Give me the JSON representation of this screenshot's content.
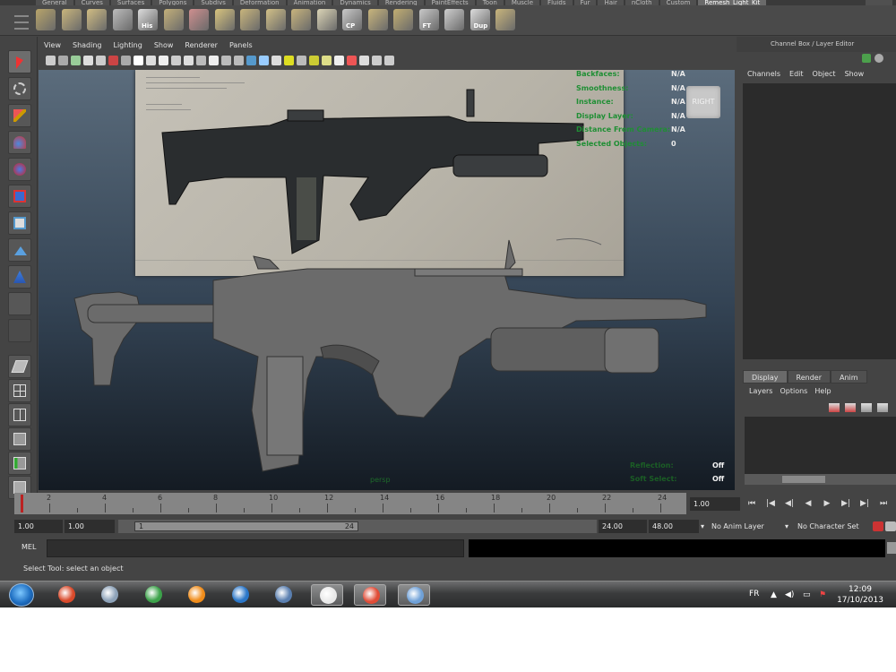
{
  "shelf_tabs": [
    "General",
    "Curves",
    "Surfaces",
    "Polygons",
    "Subdivs",
    "Deformation",
    "Animation",
    "Dynamics",
    "Rendering",
    "PaintEffects",
    "Toon",
    "Muscle",
    "Fluids",
    "Fur",
    "Hair",
    "nCloth",
    "Custom",
    "Remesh_Light_Kit"
  ],
  "shelf_icons": [
    {
      "name": "poly-cube-icon",
      "color": "#b8a46a",
      "label": ""
    },
    {
      "name": "poly-sphere-icon",
      "color": "#c9b57c",
      "label": ""
    },
    {
      "name": "extrude-icon",
      "color": "#d1bd83",
      "label": ""
    },
    {
      "name": "bevel-icon",
      "color": "#bcbcbc",
      "label": ""
    },
    {
      "name": "history-icon",
      "color": "#dddddd",
      "label": "His"
    },
    {
      "name": "merge-icon",
      "color": "#c4b07a",
      "label": ""
    },
    {
      "name": "split-icon",
      "color": "#cf8f8f",
      "label": ""
    },
    {
      "name": "grid-icon",
      "color": "#d8c47e",
      "label": ""
    },
    {
      "name": "plane-icon",
      "color": "#c9b57c",
      "label": ""
    },
    {
      "name": "cube-icon",
      "color": "#d2c087",
      "label": ""
    },
    {
      "name": "cylinder-icon",
      "color": "#c8b47d",
      "label": ""
    },
    {
      "name": "uv-icon",
      "color": "#dcd5b6",
      "label": ""
    },
    {
      "name": "center-pivot-icon",
      "color": "#c8c8c8",
      "label": "CP"
    },
    {
      "name": "barrel-icon",
      "color": "#c9b57c",
      "label": ""
    },
    {
      "name": "sphere-ball-icon",
      "color": "#c2ae72",
      "label": ""
    },
    {
      "name": "freeze-transform-icon",
      "color": "#c8c8c8",
      "label": "FT"
    },
    {
      "name": "layer-icon",
      "color": "#cfcfcf",
      "label": ""
    },
    {
      "name": "duplicate-icon",
      "color": "#dddddd",
      "label": "Dup"
    },
    {
      "name": "cone-icon",
      "color": "#c9b57c",
      "label": ""
    }
  ],
  "viewport": {
    "menus": [
      "View",
      "Shading",
      "Lighting",
      "Show",
      "Renderer",
      "Panels"
    ],
    "hud": [
      {
        "label": "Backfaces:",
        "value": "N/A"
      },
      {
        "label": "Smoothness:",
        "value": "N/A"
      },
      {
        "label": "Instance:",
        "value": "N/A"
      },
      {
        "label": "Display Layer:",
        "value": "N/A"
      },
      {
        "label": "Distance From Camera:",
        "value": "N/A"
      },
      {
        "label": "Selected Objects:",
        "value": "0"
      }
    ],
    "view_cube_label": "RIGHT",
    "camera_label": "persp",
    "reflections_label": "Reflection:",
    "reflections_value": "Off",
    "soft_select_label": "Soft Select:",
    "soft_select_value": "Off"
  },
  "channel_box": {
    "title": "Channel Box / Layer Editor",
    "menus": [
      "Channels",
      "Edit",
      "Object",
      "Show"
    ]
  },
  "layer_editor": {
    "tabs": [
      "Display",
      "Render",
      "Anim"
    ],
    "menus": [
      "Layers",
      "Options",
      "Help"
    ]
  },
  "time_slider": {
    "ticks": [
      2,
      4,
      6,
      8,
      10,
      12,
      14,
      16,
      18,
      20,
      22,
      24
    ],
    "current_frame": "1.00"
  },
  "range_slider": {
    "start_frame": "1.00",
    "playback_start": "1.00",
    "handle_start": "1",
    "handle_end": "24",
    "playback_end": "24.00",
    "end_frame": "48.00",
    "anim_layer": "No Anim Layer",
    "character_set": "No Character Set"
  },
  "command_line": {
    "label": "MEL",
    "help": "Select Tool: select an object"
  },
  "taskbar": {
    "language": "FR",
    "time": "12:09",
    "date": "17/10/2013",
    "apps": [
      {
        "name": "app-3d-icon",
        "color": "#d94a2b",
        "running": false
      },
      {
        "name": "app-camera-icon",
        "color": "#8da2b8",
        "running": false
      },
      {
        "name": "app-globe-icon",
        "color": "#3ca24a",
        "running": false
      },
      {
        "name": "vlc-icon",
        "color": "#f08c1a",
        "running": false
      },
      {
        "name": "ccleaner-icon",
        "color": "#2a76c8",
        "running": false
      },
      {
        "name": "x-app-icon",
        "color": "#5a7fb0",
        "running": false
      },
      {
        "name": "maya-icon",
        "color": "#e9e9e9",
        "running": true
      },
      {
        "name": "chrome-icon",
        "color": "#e04b36",
        "running": true
      },
      {
        "name": "paint-icon",
        "color": "#6fa1d8",
        "running": true
      }
    ]
  },
  "colors": {
    "hud_label": "#1f8f34",
    "viewport_top": "#5b6c7c",
    "viewport_bottom": "#141b23"
  }
}
